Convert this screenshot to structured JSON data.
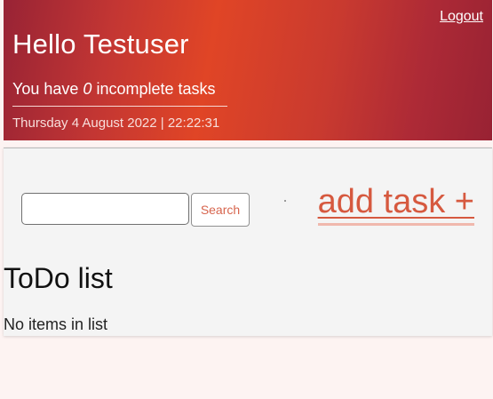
{
  "header": {
    "logout_label": "Logout",
    "greeting": "Hello Testuser",
    "incomplete_prefix": "You have ",
    "incomplete_count": "0",
    "incomplete_suffix": " incomplete tasks",
    "datetime": "Thursday 4 August 2022 | 22:22:31"
  },
  "search": {
    "value": "",
    "placeholder": "",
    "button_label": "Search"
  },
  "add_task_label": "add task +",
  "todo": {
    "title": "ToDo list",
    "empty_message": "No items in list",
    "items": []
  },
  "colors": {
    "accent": "#d6593f",
    "header_gradient_center": "#e04526",
    "header_gradient_edge": "#982335"
  }
}
